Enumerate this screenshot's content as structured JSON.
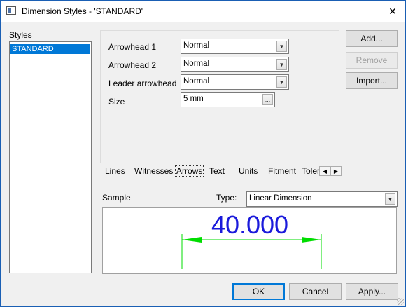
{
  "window": {
    "title": "Dimension Styles - 'STANDARD'"
  },
  "styles": {
    "label": "Styles",
    "items": [
      "STANDARD"
    ]
  },
  "form": {
    "arrowhead1": {
      "label": "Arrowhead 1",
      "value": "Normal"
    },
    "arrowhead2": {
      "label": "Arrowhead 2",
      "value": "Normal"
    },
    "leader": {
      "label": "Leader arrowhead",
      "value": "Normal"
    },
    "size": {
      "label": "Size",
      "value": "5 mm",
      "browse": "..."
    }
  },
  "side_buttons": {
    "add": "Add...",
    "remove": "Remove",
    "import": "Import..."
  },
  "tabs": [
    "Lines",
    "Witnesses",
    "Arrows",
    "Text",
    "Units",
    "Fitment",
    "Toler"
  ],
  "active_tab": "Arrows",
  "sample": {
    "label": "Sample",
    "type_label": "Type:",
    "type_value": "Linear Dimension",
    "dimension_text": "40.000",
    "text_color": "#1a1adb",
    "line_color": "#00dd00"
  },
  "bottom_buttons": {
    "ok": "OK",
    "cancel": "Cancel",
    "apply": "Apply..."
  }
}
